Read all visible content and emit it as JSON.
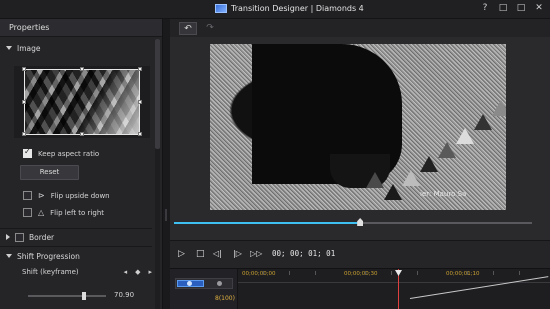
{
  "window": {
    "title": "Transition Designer  |  Diamonds 4",
    "controls": [
      "?",
      "□",
      "□",
      "✕"
    ]
  },
  "properties": {
    "header": "Properties",
    "image_section": "Image",
    "keep_aspect_ratio": {
      "label": "Keep aspect ratio",
      "checked": true
    },
    "reset_label": "Reset",
    "flip_upside_down": {
      "label": "Flip upside down",
      "checked": false
    },
    "flip_left_to_right": {
      "label": "Flip left to right",
      "checked": false
    },
    "border_section": "Border",
    "border_checked": false,
    "shift_section": "Shift Progression",
    "shift_label": "Shift (keyframe)",
    "shift_value": "70.90",
    "shift_fraction": 0.72
  },
  "toolbar": {
    "undo": "↶",
    "redo": "↷"
  },
  "preview": {
    "watermark": "ier: Mauro Sa",
    "progress_fraction": 0.52
  },
  "transport": {
    "play": "▷",
    "stop": "□",
    "prev_frame": "◁|",
    "next_frame": "|▷",
    "fast_forward": "▷▷",
    "timecode": "00; 00; 01; 01"
  },
  "timeline": {
    "track_label": "8(100)",
    "ruler": [
      "00;00;00;00",
      "00;00;00;30",
      "00;00;01;10"
    ]
  },
  "colors": {
    "accent": "#3ec0f0",
    "playhead": "#e04040",
    "ruler_text": "#c9a030"
  }
}
